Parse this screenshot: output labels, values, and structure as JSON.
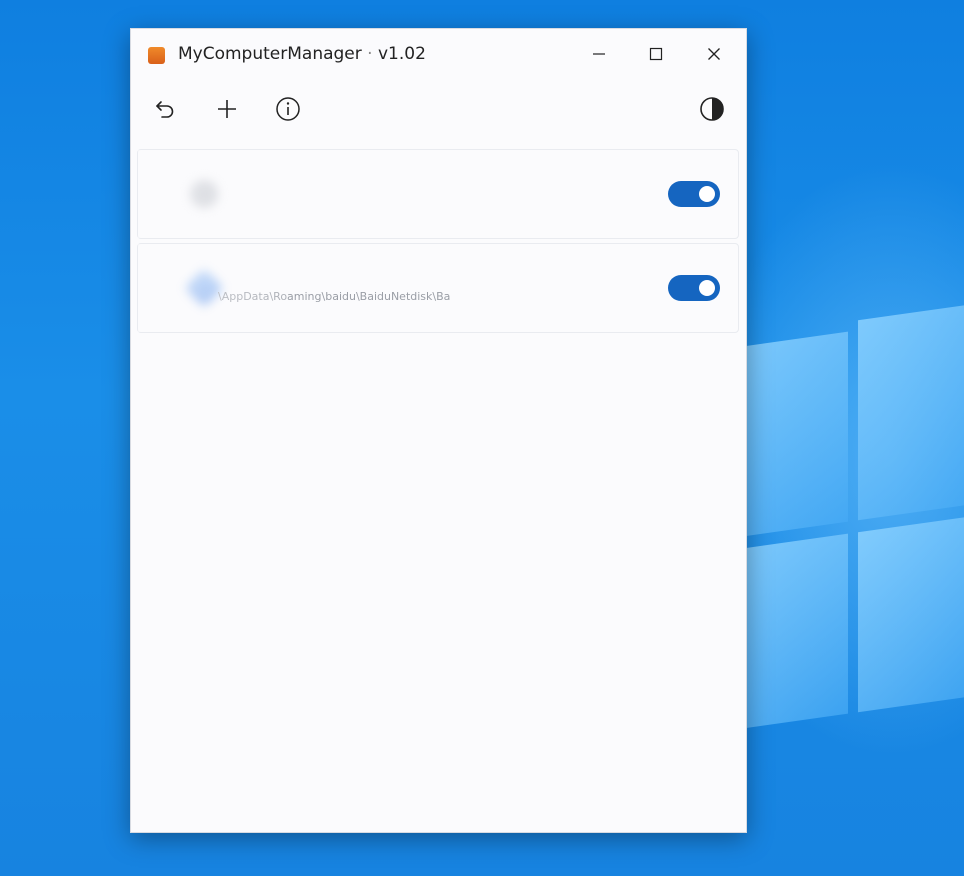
{
  "window": {
    "app_name": "MyComputerManager",
    "separator": "·",
    "version": "v1.02",
    "app_icon": "orange-square-icon",
    "controls": {
      "minimize_icon": "minimize-icon",
      "maximize_icon": "maximize-icon",
      "close_icon": "close-icon"
    }
  },
  "toolbar": {
    "undo_icon": "undo-icon",
    "add_icon": "plus-icon",
    "info_icon": "info-icon",
    "theme_icon": "contrast-icon"
  },
  "items": [
    {
      "name": "",
      "path": "",
      "icon": "app-icon",
      "enabled": true
    },
    {
      "name": "",
      "path": "\\AppData\\Roaming\\baidu\\BaiduNetdisk\\Ba",
      "icon": "baidu-netdisk-icon",
      "enabled": true
    }
  ],
  "colors": {
    "toggle_on": "#1565c0",
    "desktop_blue": "#1783e0",
    "window_bg": "#fbfbfd"
  }
}
